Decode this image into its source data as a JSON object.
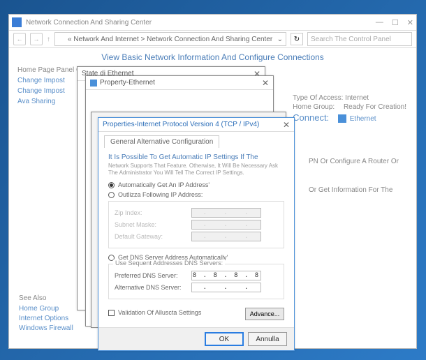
{
  "window": {
    "title": "Network Connection And Sharing Center",
    "breadcrumb": "« Network And Internet > Network Connection And Sharing Center",
    "search_placeholder": "Search The Control Panel"
  },
  "content": {
    "header": "View Basic Network Information And Configure Connections",
    "sidebar": {
      "panel_title": "Home Page Panel Control",
      "links": [
        "Change Impost",
        "Change Impost",
        "Ava Sharing"
      ]
    },
    "right": {
      "access": "Type Of Access: Internet",
      "homegroup_label": "Home Group:",
      "homegroup_value": "Ready For Creation!",
      "connect_label": "Connect:",
      "connect_value": "Ethernet"
    },
    "hints": [
      "PN Or Configure A Router Or",
      "Or Get Information For The"
    ],
    "see_also": {
      "title": "See Also",
      "links": [
        "Home Group",
        "Internet Options",
        "Windows Firewall"
      ]
    }
  },
  "dlg1": {
    "title": "State di Ethernet"
  },
  "dlg2": {
    "title": "Property-Ethernet"
  },
  "dlg4": {
    "title": "Properties-Internet Protocol Version 4 (TCP / IPv4)",
    "tab": "General Alternative Configuration",
    "info": "It Is Possible To Get Automatic IP Settings If The",
    "info_sub": "Network Supports That Feature. Otherwise, It Will Be Necessary Ask The Administrator You Will Tell The Correct IP Settings.",
    "radio_auto_ip": "Automatically Get An IP Address'",
    "radio_manual_ip": "Outlizza Following IP Address:",
    "fields_ip": {
      "ip": "Zip Index:",
      "mask": "Subnet Maske:",
      "gateway": "Default Gateway:"
    },
    "radio_auto_dns": "Get DNS Server Address Automatically'",
    "dns_group_label": "Use Sequent Addresses DNS Servers:",
    "fields_dns": {
      "preferred_label": "Preferred DNS Server:",
      "preferred_value": "8 . 8 . 8 . 8",
      "alt_label": "Alternative DNS Server:"
    },
    "validate": "Validation Of Alluscta Settings",
    "advance": "Advance...",
    "ok": "OK",
    "cancel": "Annulla"
  }
}
